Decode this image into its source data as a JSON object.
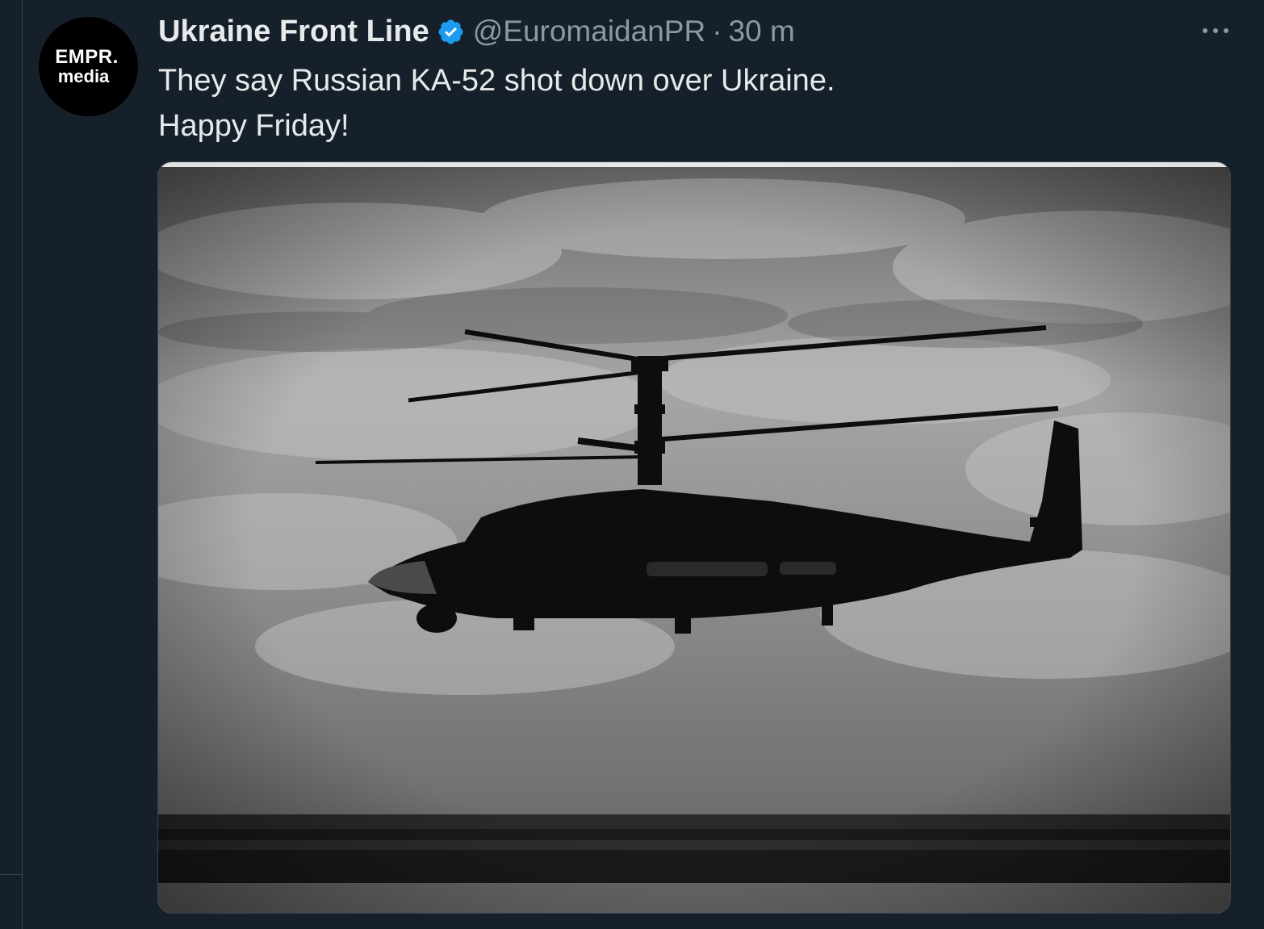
{
  "tweet": {
    "author_name": "Ukraine Front Line",
    "handle": "@EuromaidanPR",
    "separator": "·",
    "time": "30 m",
    "verified": true,
    "avatar": {
      "line1": "EMPR.",
      "line2": "media",
      "icon": "avatar"
    },
    "text_lines": [
      "They say Russian KA-52 shot down over Ukraine.",
      "Happy Friday!"
    ],
    "media": {
      "type": "photo",
      "icon": "helicopter-photo"
    },
    "more_icon": "more-options-icon"
  },
  "colors": {
    "background": "#15202b",
    "text_primary": "#e7e9ea",
    "text_secondary": "#8b98a5",
    "verified_badge": "#1d9bf0",
    "border": "#38444d"
  }
}
